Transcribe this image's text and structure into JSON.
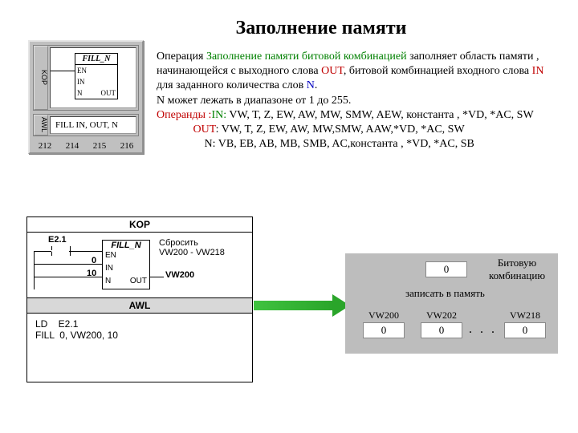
{
  "title": "Заполнение памяти",
  "toolblock": {
    "kop_tab": "KOP",
    "awl_tab": "AWL",
    "fill_box": {
      "name": "FILL_N",
      "en": "EN",
      "in": "IN",
      "n": "N",
      "out": "OUT"
    },
    "awl_line": "FILL IN, OUT, N",
    "ruler": [
      "212",
      "214",
      "215",
      "216"
    ]
  },
  "descr": {
    "l1a": "Операция ",
    "l1b": "Заполнение памяти битовой комбинацией",
    "l1c": " заполняет область памяти , начинающейся с выходного слова ",
    "l1d": "OUT",
    "l1e": ", битовой комбинацией входного слова ",
    "l1f": "IN",
    "l1g": " для заданного количества слов ",
    "l1h": "N",
    "l1i": ".",
    "l2": " N может лежать в диапазоне от 1 до 255.",
    "l3a": "Операнды :",
    "l3b": "IN:",
    "l3c": " VW, T, Z, EW, AW, MW, SMW, AEW, константа , *VD, *AC, SW",
    "l4a": "OUT",
    "l4b": ": VW, T, Z, EW, AW, MW,SMW, AAW,*VD, *AC, SW",
    "l5": "N: VB, EB, AB, MB, SMB, AC,константа , *VD, *AC, SB"
  },
  "code": {
    "kop_title": "KOP",
    "contact": "E2.1",
    "box": {
      "name": "FILL_N",
      "en": "EN",
      "in": "IN",
      "n": "N",
      "out": "OUT"
    },
    "in_val": "0",
    "n_val": "10",
    "out_val": "VW200",
    "reset_lbl": "Сбросить",
    "reset_rng": "VW200 - VW218",
    "awl_title": "AWL",
    "awl_code": "LD    E2.1\nFILL  0, VW200, 10"
  },
  "mem": {
    "cap1": "Битовую комбинацию",
    "top_val": "0",
    "cap2": "записать в память",
    "cells": [
      {
        "lbl": "VW200",
        "val": "0"
      },
      {
        "lbl": "VW202",
        "val": "0"
      },
      {
        "lbl": "VW218",
        "val": "0"
      }
    ],
    "dots": ". . ."
  }
}
